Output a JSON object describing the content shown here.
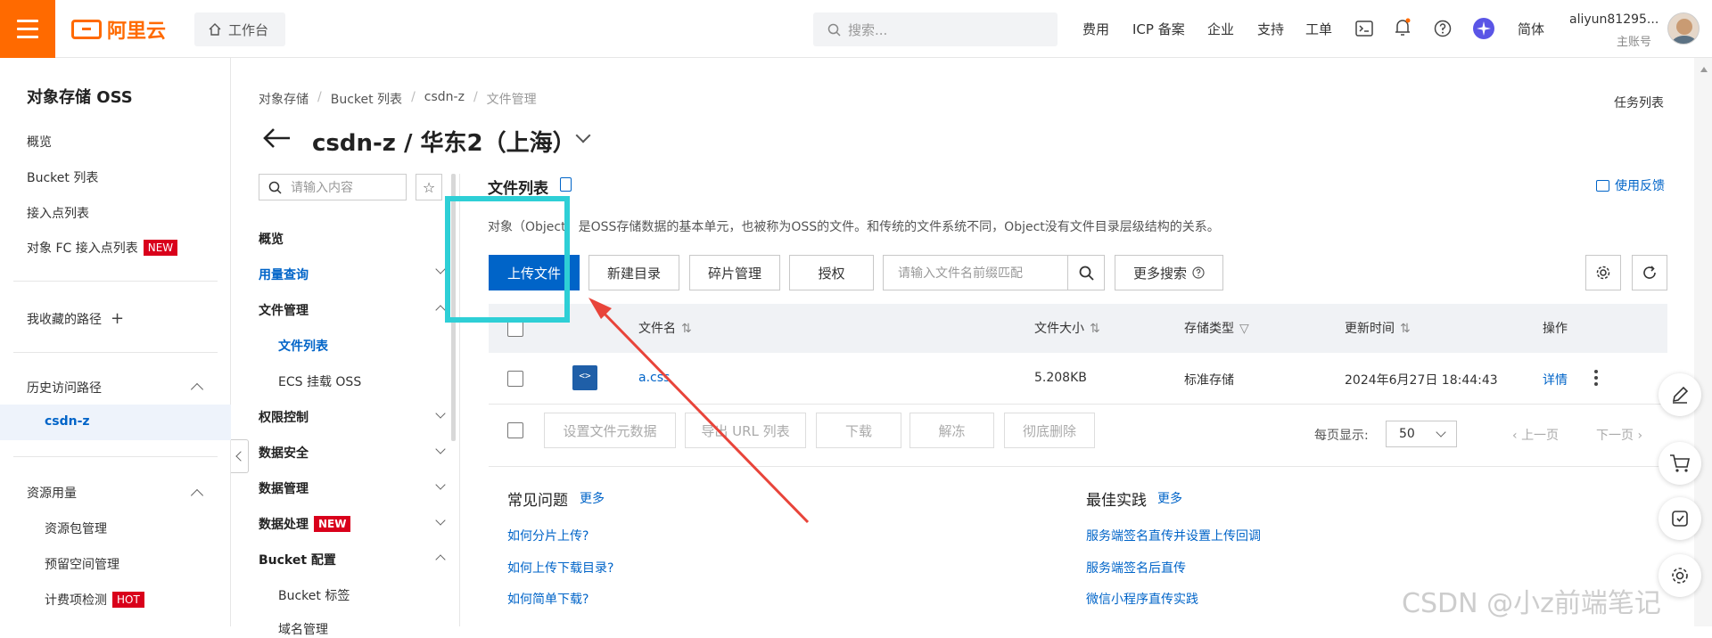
{
  "header": {
    "logo_text": "阿里云",
    "workspace": "工作台",
    "search_placeholder": "搜索...",
    "links": [
      "费用",
      "ICP 备案",
      "企业",
      "支持",
      "工单"
    ],
    "language": "简体",
    "user_name": "aliyun81295...",
    "user_role": "主账号",
    "accent_color": "#ff6a00"
  },
  "sidebar": {
    "title": "对象存储 OSS",
    "items": [
      "概览",
      "Bucket 列表",
      "接入点列表",
      "对象 FC 接入点列表"
    ],
    "new_badge": "NEW",
    "favorites": "我收藏的路径",
    "history": "历史访问路径",
    "history_item": "csdn-z",
    "resources": "资源用量",
    "resource_items": [
      "资源包管理",
      "预留空间管理",
      "计费项检测"
    ],
    "hot_badge": "HOT"
  },
  "breadcrumb": [
    "对象存储",
    "Bucket 列表",
    "csdn-z",
    "文件管理"
  ],
  "task_list": "任务列表",
  "page_title": "csdn-z / 华东2（上海）",
  "nav2": {
    "search_placeholder": "请输入内容",
    "items": {
      "overview": "概览",
      "usage": "用量查询",
      "file_mgmt": "文件管理",
      "file_list": "文件列表",
      "ecs_mount": "ECS 挂载 OSS",
      "permission": "权限控制",
      "data_security": "数据安全",
      "data_mgmt": "数据管理",
      "data_process": "数据处理",
      "bucket_config": "Bucket 配置",
      "bucket_tag": "Bucket 标签",
      "cut_item": "域名管理"
    }
  },
  "main": {
    "title": "文件列表",
    "feedback": "使用反馈",
    "description": "对象（Object）是OSS存储数据的基本单元，也被称为OSS的文件。和传统的文件系统不同，Object没有文件目录层级结构的关系。",
    "buttons": {
      "upload": "上传文件",
      "new_dir": "新建目录",
      "fragments": "碎片管理",
      "authorize": "授权",
      "more_search": "更多搜索"
    },
    "prefix_placeholder": "请输入文件名前缀匹配",
    "columns": [
      "文件名",
      "文件大小",
      "存储类型",
      "更新时间",
      "操作"
    ],
    "rows": [
      {
        "name": "a.css",
        "size": "5.208KB",
        "storage": "标准存储",
        "updated": "2024年6月27日 18:44:43",
        "action": "详情"
      }
    ],
    "bulk_buttons": [
      "设置文件元数据",
      "导出 URL 列表",
      "下载",
      "解冻",
      "彻底删除"
    ],
    "per_page_label": "每页显示:",
    "per_page_value": "50",
    "prev": "上一页",
    "next": "下一页"
  },
  "faq": {
    "title": "常见问题",
    "more": "更多",
    "items": [
      "如何分片上传?",
      "如何上传下载目录?",
      "如何简单下载?"
    ]
  },
  "best_practice": {
    "title": "最佳实践",
    "more": "更多",
    "items": [
      "服务端签名直传并设置上传回调",
      "服务端签名后直传",
      "微信小程序直传实践"
    ]
  },
  "watermark": "CSDN @小z前端笔记"
}
